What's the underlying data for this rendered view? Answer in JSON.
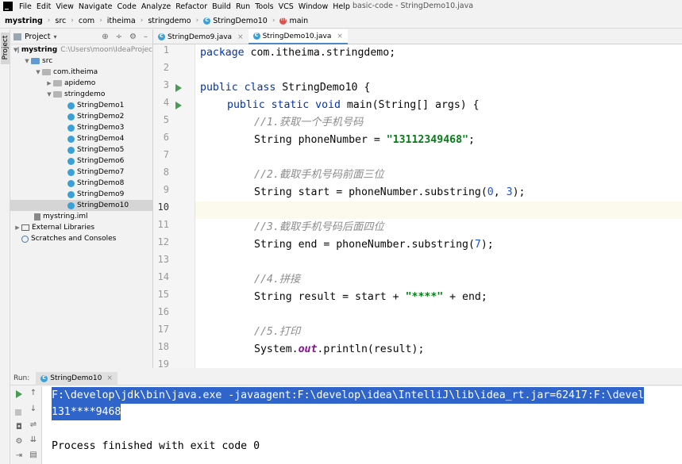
{
  "menubar": {
    "items": [
      "File",
      "Edit",
      "View",
      "Navigate",
      "Code",
      "Analyze",
      "Refactor",
      "Build",
      "Run",
      "Tools",
      "VCS",
      "Window",
      "Help"
    ],
    "window_title": "basic-code - StringDemo10.java"
  },
  "navbar": {
    "crumbs": [
      "mystring",
      "src",
      "com",
      "itheima",
      "stringdemo",
      "StringDemo10",
      "main"
    ]
  },
  "side_strip": {
    "project_tab": "Project"
  },
  "project_panel": {
    "title": "Project",
    "tree": [
      {
        "label": "mystring",
        "path": "C:\\Users\\moon\\IdeaProjec",
        "icon": "folder-icon"
      },
      {
        "label": "src",
        "icon": "source-folder-icon"
      },
      {
        "label": "com.itheima",
        "icon": "package-icon"
      },
      {
        "label": "apidemo",
        "icon": "package-icon"
      },
      {
        "label": "stringdemo",
        "icon": "package-icon"
      },
      {
        "label": "StringDemo1",
        "icon": "java-class-icon"
      },
      {
        "label": "StringDemo2",
        "icon": "java-class-icon"
      },
      {
        "label": "StringDemo3",
        "icon": "java-class-icon"
      },
      {
        "label": "StringDemo4",
        "icon": "java-class-icon"
      },
      {
        "label": "StringDemo5",
        "icon": "java-class-icon"
      },
      {
        "label": "StringDemo6",
        "icon": "java-class-icon"
      },
      {
        "label": "StringDemo7",
        "icon": "java-class-icon"
      },
      {
        "label": "StringDemo8",
        "icon": "java-class-icon"
      },
      {
        "label": "StringDemo9",
        "icon": "java-class-icon"
      },
      {
        "label": "StringDemo10",
        "icon": "java-class-icon",
        "selected": true
      },
      {
        "label": "mystring.iml",
        "icon": "iml-file-icon"
      },
      {
        "label": "External Libraries",
        "icon": "library-icon"
      },
      {
        "label": "Scratches and Consoles",
        "icon": "scratch-icon"
      }
    ]
  },
  "editor": {
    "tabs": [
      {
        "label": "StringDemo9.java",
        "active": false
      },
      {
        "label": "StringDemo10.java",
        "active": true
      }
    ],
    "line_numbers": [
      "1",
      "2",
      "3",
      "4",
      "5",
      "6",
      "7",
      "8",
      "9",
      "10",
      "11",
      "12",
      "13",
      "14",
      "15",
      "16",
      "17",
      "18",
      "19"
    ],
    "current_line": 10,
    "code": {
      "l1_kw": "package",
      "l1_rest": " com.itheima.stringdemo;",
      "l3_kw": "public class",
      "l3_rest": " StringDemo10 {",
      "l4_kw": "public static void",
      "l4_rest": " main(String[] args) {",
      "l5": "//1.获取一个手机号码",
      "l6_a": "String phoneNumber = ",
      "l6_str": "\"13112349468\"",
      "l6_b": ";",
      "l8": "//2.截取手机号码前面三位",
      "l9_a": "String start = phoneNumber.substring(",
      "l9_n1": "0",
      "l9_b": ", ",
      "l9_n2": "3",
      "l9_c": ");",
      "l11": "//3.截取手机号码后面四位",
      "l12_a": "String end = phoneNumber.substring(",
      "l12_n": "7",
      "l12_b": ");",
      "l14": "//4.拼接",
      "l15_a": "String result = start + ",
      "l15_str": "\"****\"",
      "l15_b": " + end;",
      "l17": "//5.打印",
      "l18_a": "System.",
      "l18_fld": "out",
      "l18_b": ".println(result);"
    }
  },
  "run_panel": {
    "label": "Run:",
    "tab": "StringDemo10",
    "console": {
      "command": "F:\\develop\\jdk\\bin\\java.exe -javaagent:F:\\develop\\idea\\IntelliJ\\lib\\idea_rt.jar=62417:F:\\devel",
      "output": "131****9468",
      "exit": "Process finished with exit code 0"
    }
  }
}
